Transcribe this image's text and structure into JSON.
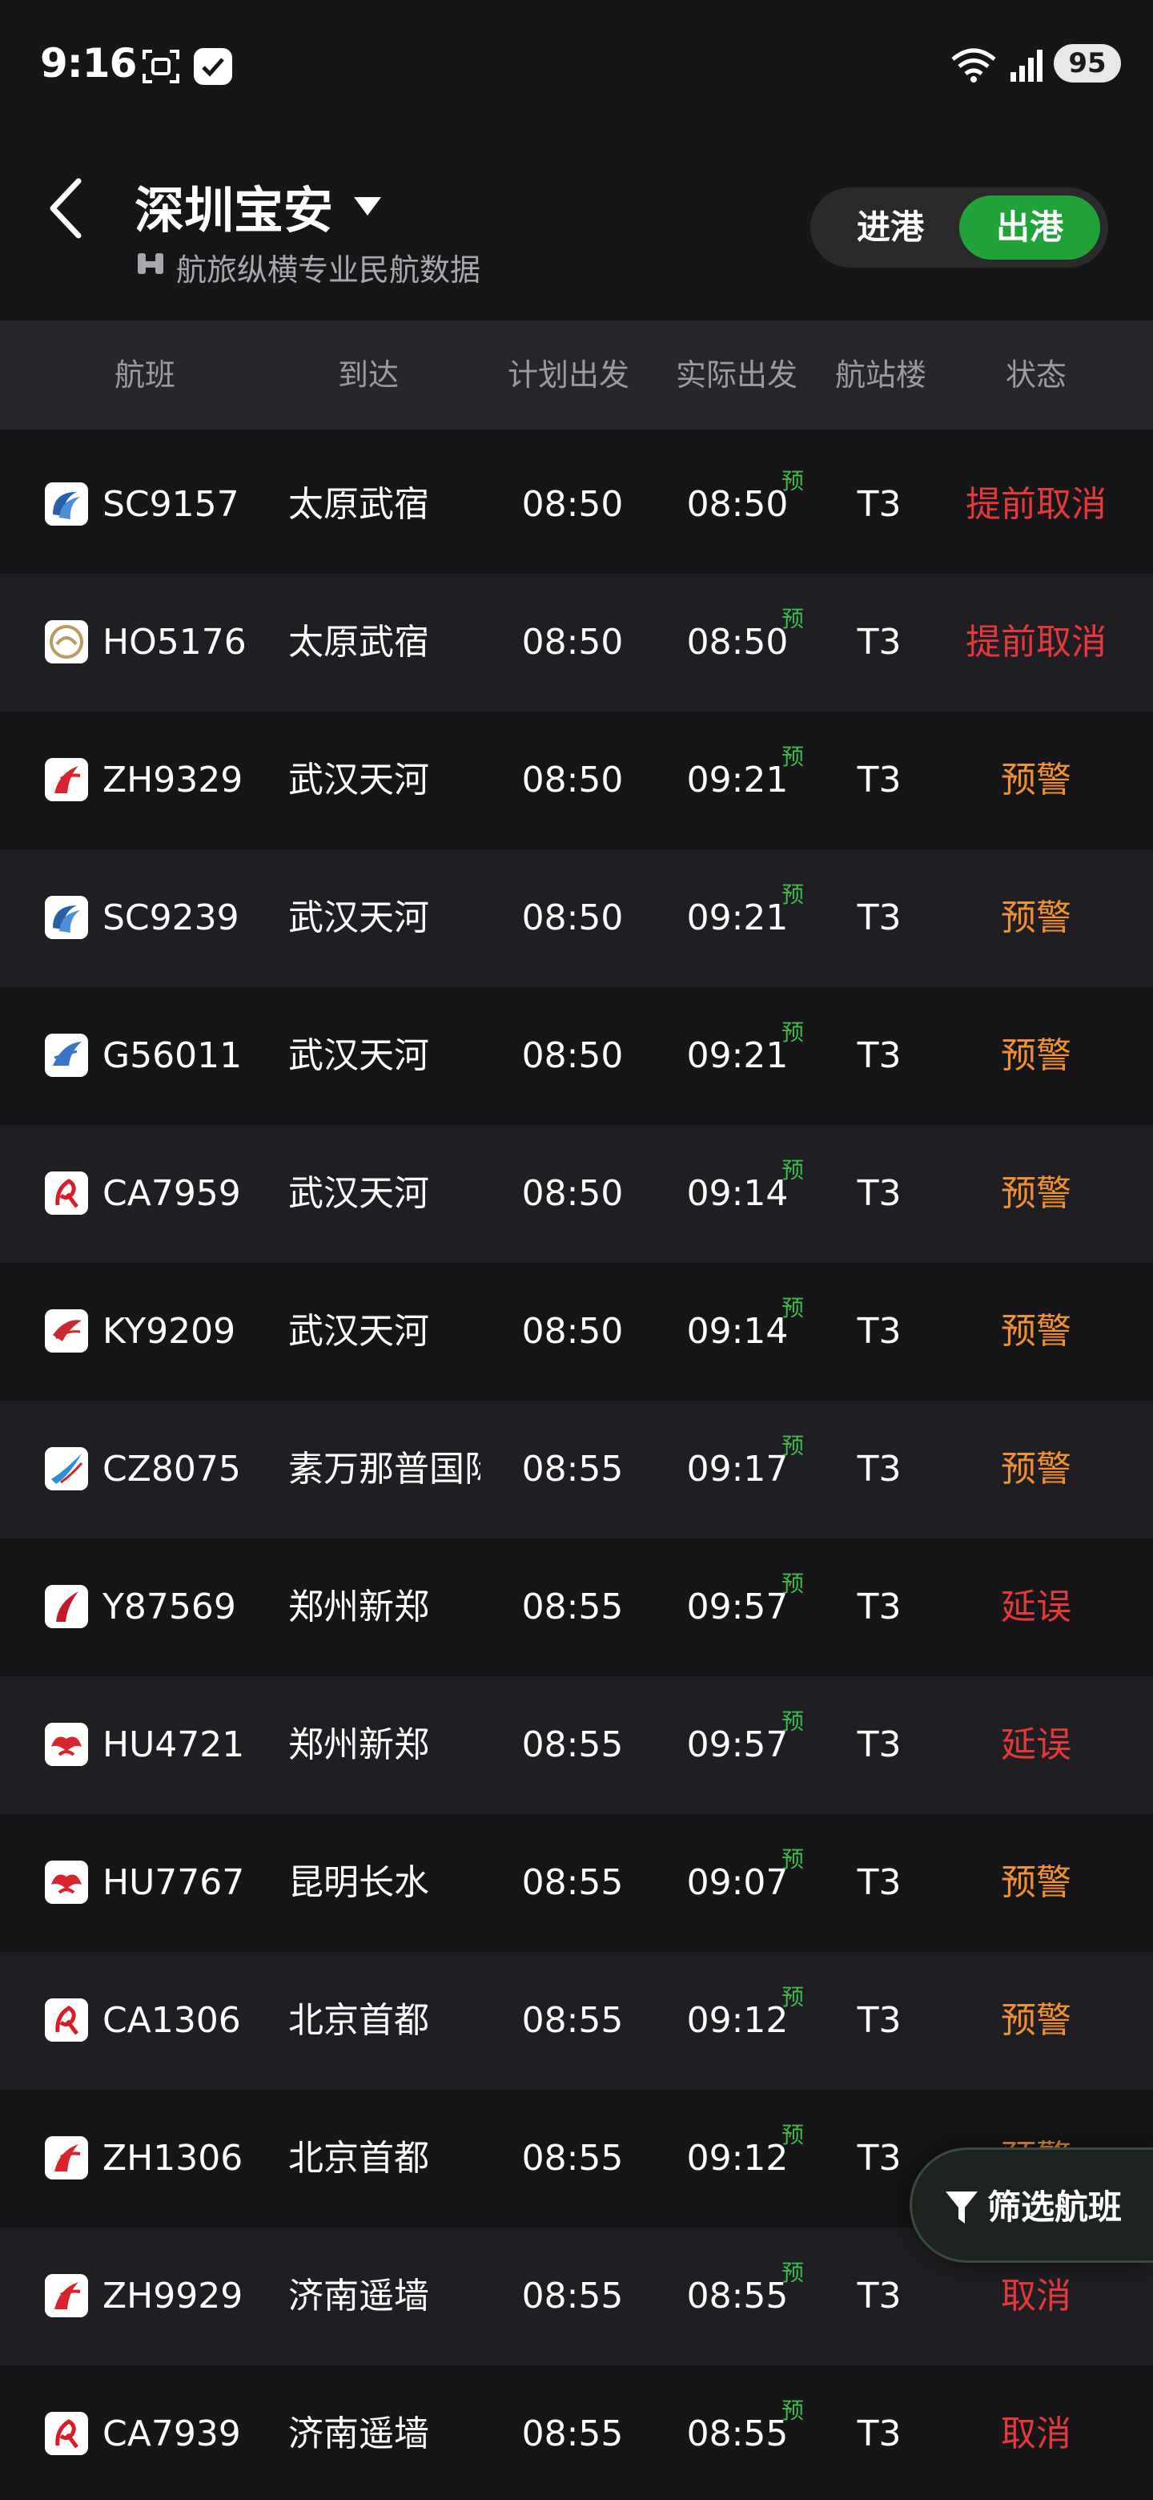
{
  "status_bar": {
    "time": "9:16",
    "battery": "95"
  },
  "header": {
    "title": "深圳宝安",
    "subtitle": "航旅纵横专业民航数据",
    "tabs": [
      {
        "label": "进港",
        "selected": false
      },
      {
        "label": "出港",
        "selected": true
      }
    ]
  },
  "table": {
    "columns": [
      "航班",
      "到达",
      "计划出发",
      "实际出发",
      "航站楼",
      "状态"
    ],
    "estimate_mark": "预",
    "rows": [
      {
        "airline_icon": "sichuan-airlines-icon",
        "flight": "SC9157",
        "dest": "太原武宿",
        "planned": "08:50",
        "actual": "08:50",
        "terminal": "T3",
        "status": "提前取消",
        "status_color": "#e5383b"
      },
      {
        "airline_icon": "loong-air-icon",
        "flight": "HO5176",
        "dest": "太原武宿",
        "planned": "08:50",
        "actual": "08:50",
        "terminal": "T3",
        "status": "提前取消",
        "status_color": "#e5383b"
      },
      {
        "airline_icon": "shenzhen-airlines-icon",
        "flight": "ZH9329",
        "dest": "武汉天河",
        "planned": "08:50",
        "actual": "09:21",
        "terminal": "T3",
        "status": "预警",
        "status_color": "#f0902e"
      },
      {
        "airline_icon": "sichuan-airlines-icon",
        "flight": "SC9239",
        "dest": "武汉天河",
        "planned": "08:50",
        "actual": "09:21",
        "terminal": "T3",
        "status": "预警",
        "status_color": "#f0902e"
      },
      {
        "airline_icon": "tibet-airlines-icon",
        "flight": "G56011",
        "dest": "武汉天河",
        "planned": "08:50",
        "actual": "09:21",
        "terminal": "T3",
        "status": "预警",
        "status_color": "#f0902e"
      },
      {
        "airline_icon": "air-china-icon",
        "flight": "CA7959",
        "dest": "武汉天河",
        "planned": "08:50",
        "actual": "09:14",
        "terminal": "T3",
        "status": "预警",
        "status_color": "#f0902e"
      },
      {
        "airline_icon": "kunming-airlines-icon",
        "flight": "KY9209",
        "dest": "武汉天河",
        "planned": "08:50",
        "actual": "09:14",
        "terminal": "T3",
        "status": "预警",
        "status_color": "#f0902e"
      },
      {
        "airline_icon": "china-southern-icon",
        "flight": "CZ8075",
        "dest": "素万那普国际",
        "planned": "08:55",
        "actual": "09:17",
        "terminal": "T3",
        "status": "预警",
        "status_color": "#f0902e"
      },
      {
        "airline_icon": "tianjin-airlines-icon",
        "flight": "Y87569",
        "dest": "郑州新郑",
        "planned": "08:55",
        "actual": "09:57",
        "terminal": "T3",
        "status": "延误",
        "status_color": "#e5383b"
      },
      {
        "airline_icon": "hainan-airlines-icon",
        "flight": "HU4721",
        "dest": "郑州新郑",
        "planned": "08:55",
        "actual": "09:57",
        "terminal": "T3",
        "status": "延误",
        "status_color": "#e5383b"
      },
      {
        "airline_icon": "hainan-airlines-icon",
        "flight": "HU7767",
        "dest": "昆明长水",
        "planned": "08:55",
        "actual": "09:07",
        "terminal": "T3",
        "status": "预警",
        "status_color": "#f0902e"
      },
      {
        "airline_icon": "air-china-icon",
        "flight": "CA1306",
        "dest": "北京首都",
        "planned": "08:55",
        "actual": "09:12",
        "terminal": "T3",
        "status": "预警",
        "status_color": "#f0902e"
      },
      {
        "airline_icon": "shenzhen-airlines-icon",
        "flight": "ZH1306",
        "dest": "北京首都",
        "planned": "08:55",
        "actual": "09:12",
        "terminal": "T3",
        "status": "预警",
        "status_color": "#f0902e"
      },
      {
        "airline_icon": "shenzhen-airlines-icon",
        "flight": "ZH9929",
        "dest": "济南遥墙",
        "planned": "08:55",
        "actual": "08:55",
        "terminal": "T3",
        "status": "取消",
        "status_color": "#e5383b"
      },
      {
        "airline_icon": "air-china-icon",
        "flight": "CA7939",
        "dest": "济南遥墙",
        "planned": "08:55",
        "actual": "08:55",
        "terminal": "T3",
        "status": "取消",
        "status_color": "#e5383b"
      }
    ]
  },
  "filter_button": {
    "label": "筛选航班"
  },
  "colors": {
    "accent_green": "#21a33a",
    "cancel_red": "#e5383b",
    "warn_orange": "#f0902e",
    "estimate_green": "#3dbb4c"
  }
}
